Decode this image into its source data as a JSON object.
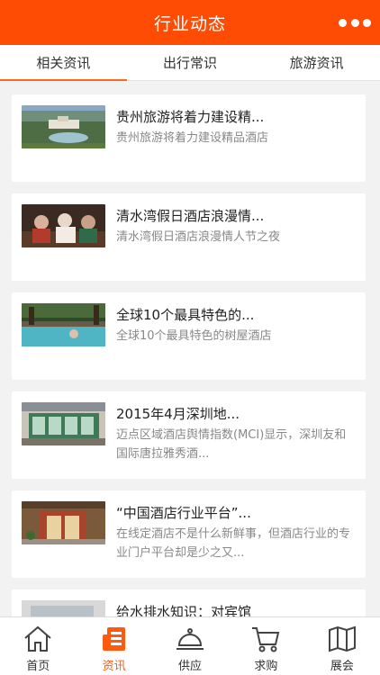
{
  "header": {
    "title": "行业动态",
    "more_icon": "more-dots-icon"
  },
  "tabs": [
    {
      "label": "相关资讯",
      "active": true
    },
    {
      "label": "出行常识",
      "active": false
    },
    {
      "label": "旅游资讯",
      "active": false
    }
  ],
  "articles": [
    {
      "title": "贵州旅游将着力建设精...",
      "desc": "贵州旅游将着力建设精品酒店"
    },
    {
      "title": "清水湾假日酒店浪漫情...",
      "desc": "清水湾假日酒店浪漫情人节之夜"
    },
    {
      "title": "全球10个最具特色的...",
      "desc": "全球10个最具特色的树屋酒店"
    },
    {
      "title": "2015年4月深圳地...",
      "desc": "迈点区域酒店舆情指数(MCI)显示，深圳友和国际唐拉雅秀酒..."
    },
    {
      "title": "“中国酒店行业平台”...",
      "desc": "在线定酒店不是什么新鲜事，但酒店行业的专业门户平台却是少之又..."
    },
    {
      "title": "给水排水知识：对宾馆",
      "desc": ""
    }
  ],
  "bottom_nav": [
    {
      "label": "首页",
      "icon": "home-icon",
      "active": false
    },
    {
      "label": "资讯",
      "icon": "news-icon",
      "active": true
    },
    {
      "label": "供应",
      "icon": "cloche-icon",
      "active": false
    },
    {
      "label": "求购",
      "icon": "cart-icon",
      "active": false
    },
    {
      "label": "展会",
      "icon": "map-icon",
      "active": false
    }
  ],
  "colors": {
    "brand": "#ff4c05",
    "active_text": "#ff5a10",
    "background": "#f2f2f2"
  }
}
